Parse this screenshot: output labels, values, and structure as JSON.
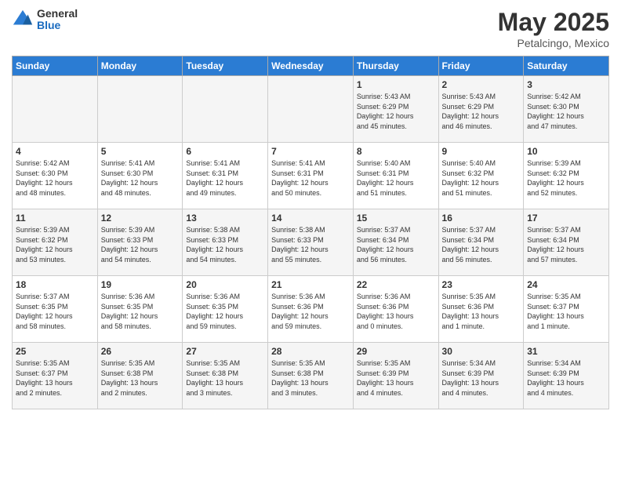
{
  "header": {
    "logo_general": "General",
    "logo_blue": "Blue",
    "month_title": "May 2025",
    "location": "Petalcingo, Mexico"
  },
  "days_of_week": [
    "Sunday",
    "Monday",
    "Tuesday",
    "Wednesday",
    "Thursday",
    "Friday",
    "Saturday"
  ],
  "weeks": [
    [
      {
        "day": "",
        "info": ""
      },
      {
        "day": "",
        "info": ""
      },
      {
        "day": "",
        "info": ""
      },
      {
        "day": "",
        "info": ""
      },
      {
        "day": "1",
        "info": "Sunrise: 5:43 AM\nSunset: 6:29 PM\nDaylight: 12 hours\nand 45 minutes."
      },
      {
        "day": "2",
        "info": "Sunrise: 5:43 AM\nSunset: 6:29 PM\nDaylight: 12 hours\nand 46 minutes."
      },
      {
        "day": "3",
        "info": "Sunrise: 5:42 AM\nSunset: 6:30 PM\nDaylight: 12 hours\nand 47 minutes."
      }
    ],
    [
      {
        "day": "4",
        "info": "Sunrise: 5:42 AM\nSunset: 6:30 PM\nDaylight: 12 hours\nand 48 minutes."
      },
      {
        "day": "5",
        "info": "Sunrise: 5:41 AM\nSunset: 6:30 PM\nDaylight: 12 hours\nand 48 minutes."
      },
      {
        "day": "6",
        "info": "Sunrise: 5:41 AM\nSunset: 6:31 PM\nDaylight: 12 hours\nand 49 minutes."
      },
      {
        "day": "7",
        "info": "Sunrise: 5:41 AM\nSunset: 6:31 PM\nDaylight: 12 hours\nand 50 minutes."
      },
      {
        "day": "8",
        "info": "Sunrise: 5:40 AM\nSunset: 6:31 PM\nDaylight: 12 hours\nand 51 minutes."
      },
      {
        "day": "9",
        "info": "Sunrise: 5:40 AM\nSunset: 6:32 PM\nDaylight: 12 hours\nand 51 minutes."
      },
      {
        "day": "10",
        "info": "Sunrise: 5:39 AM\nSunset: 6:32 PM\nDaylight: 12 hours\nand 52 minutes."
      }
    ],
    [
      {
        "day": "11",
        "info": "Sunrise: 5:39 AM\nSunset: 6:32 PM\nDaylight: 12 hours\nand 53 minutes."
      },
      {
        "day": "12",
        "info": "Sunrise: 5:39 AM\nSunset: 6:33 PM\nDaylight: 12 hours\nand 54 minutes."
      },
      {
        "day": "13",
        "info": "Sunrise: 5:38 AM\nSunset: 6:33 PM\nDaylight: 12 hours\nand 54 minutes."
      },
      {
        "day": "14",
        "info": "Sunrise: 5:38 AM\nSunset: 6:33 PM\nDaylight: 12 hours\nand 55 minutes."
      },
      {
        "day": "15",
        "info": "Sunrise: 5:37 AM\nSunset: 6:34 PM\nDaylight: 12 hours\nand 56 minutes."
      },
      {
        "day": "16",
        "info": "Sunrise: 5:37 AM\nSunset: 6:34 PM\nDaylight: 12 hours\nand 56 minutes."
      },
      {
        "day": "17",
        "info": "Sunrise: 5:37 AM\nSunset: 6:34 PM\nDaylight: 12 hours\nand 57 minutes."
      }
    ],
    [
      {
        "day": "18",
        "info": "Sunrise: 5:37 AM\nSunset: 6:35 PM\nDaylight: 12 hours\nand 58 minutes."
      },
      {
        "day": "19",
        "info": "Sunrise: 5:36 AM\nSunset: 6:35 PM\nDaylight: 12 hours\nand 58 minutes."
      },
      {
        "day": "20",
        "info": "Sunrise: 5:36 AM\nSunset: 6:35 PM\nDaylight: 12 hours\nand 59 minutes."
      },
      {
        "day": "21",
        "info": "Sunrise: 5:36 AM\nSunset: 6:36 PM\nDaylight: 12 hours\nand 59 minutes."
      },
      {
        "day": "22",
        "info": "Sunrise: 5:36 AM\nSunset: 6:36 PM\nDaylight: 13 hours\nand 0 minutes."
      },
      {
        "day": "23",
        "info": "Sunrise: 5:35 AM\nSunset: 6:36 PM\nDaylight: 13 hours\nand 1 minute."
      },
      {
        "day": "24",
        "info": "Sunrise: 5:35 AM\nSunset: 6:37 PM\nDaylight: 13 hours\nand 1 minute."
      }
    ],
    [
      {
        "day": "25",
        "info": "Sunrise: 5:35 AM\nSunset: 6:37 PM\nDaylight: 13 hours\nand 2 minutes."
      },
      {
        "day": "26",
        "info": "Sunrise: 5:35 AM\nSunset: 6:38 PM\nDaylight: 13 hours\nand 2 minutes."
      },
      {
        "day": "27",
        "info": "Sunrise: 5:35 AM\nSunset: 6:38 PM\nDaylight: 13 hours\nand 3 minutes."
      },
      {
        "day": "28",
        "info": "Sunrise: 5:35 AM\nSunset: 6:38 PM\nDaylight: 13 hours\nand 3 minutes."
      },
      {
        "day": "29",
        "info": "Sunrise: 5:35 AM\nSunset: 6:39 PM\nDaylight: 13 hours\nand 4 minutes."
      },
      {
        "day": "30",
        "info": "Sunrise: 5:34 AM\nSunset: 6:39 PM\nDaylight: 13 hours\nand 4 minutes."
      },
      {
        "day": "31",
        "info": "Sunrise: 5:34 AM\nSunset: 6:39 PM\nDaylight: 13 hours\nand 4 minutes."
      }
    ]
  ]
}
